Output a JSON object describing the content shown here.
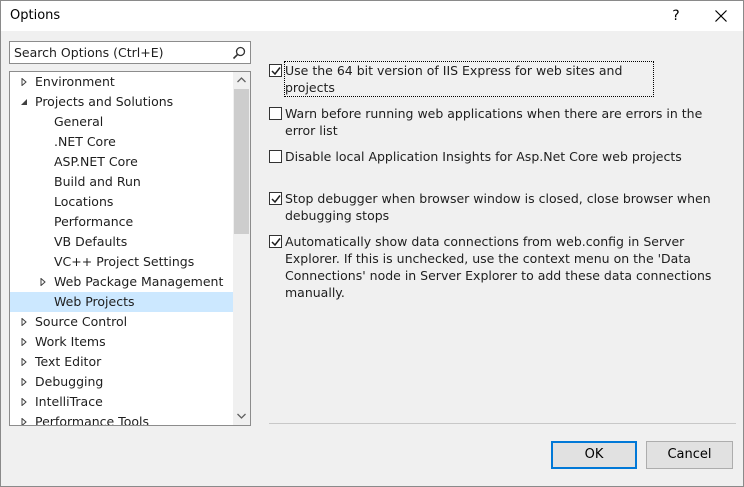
{
  "window": {
    "title": "Options",
    "help_label": "?"
  },
  "search": {
    "text": "Search Options (Ctrl+E)"
  },
  "tree": {
    "items": [
      {
        "label": "Environment",
        "level": 0,
        "expander": "collapsed",
        "selected": false
      },
      {
        "label": "Projects and Solutions",
        "level": 0,
        "expander": "expanded",
        "selected": false
      },
      {
        "label": "General",
        "level": 1,
        "expander": "none",
        "selected": false
      },
      {
        "label": ".NET Core",
        "level": 1,
        "expander": "none",
        "selected": false
      },
      {
        "label": "ASP.NET Core",
        "level": 1,
        "expander": "none",
        "selected": false
      },
      {
        "label": "Build and Run",
        "level": 1,
        "expander": "none",
        "selected": false
      },
      {
        "label": "Locations",
        "level": 1,
        "expander": "none",
        "selected": false
      },
      {
        "label": "Performance",
        "level": 1,
        "expander": "none",
        "selected": false
      },
      {
        "label": "VB Defaults",
        "level": 1,
        "expander": "none",
        "selected": false
      },
      {
        "label": "VC++ Project Settings",
        "level": 1,
        "expander": "none",
        "selected": false
      },
      {
        "label": "Web Package Management",
        "level": 1,
        "expander": "collapsed",
        "selected": false
      },
      {
        "label": "Web Projects",
        "level": 1,
        "expander": "none",
        "selected": true
      },
      {
        "label": "Source Control",
        "level": 0,
        "expander": "collapsed",
        "selected": false
      },
      {
        "label": "Work Items",
        "level": 0,
        "expander": "collapsed",
        "selected": false
      },
      {
        "label": "Text Editor",
        "level": 0,
        "expander": "collapsed",
        "selected": false
      },
      {
        "label": "Debugging",
        "level": 0,
        "expander": "collapsed",
        "selected": false
      },
      {
        "label": "IntelliTrace",
        "level": 0,
        "expander": "collapsed",
        "selected": false
      },
      {
        "label": "Performance Tools",
        "level": 0,
        "expander": "collapsed",
        "selected": false
      }
    ]
  },
  "options": [
    {
      "text": "Use the 64 bit version of IIS Express for web sites and projects",
      "checked": true
    },
    {
      "text": "Warn before running web applications when there are errors in the error list",
      "checked": false
    },
    {
      "text": "Disable local Application Insights for Asp.Net Core web projects",
      "checked": false
    },
    {
      "text": "Stop debugger when browser window is closed, close browser when debugging stops",
      "checked": true
    },
    {
      "text": "Automatically show data connections from web.config in Server Explorer. If this is unchecked, use the context menu on the 'Data Connections' node in Server Explorer to add these data connections manually.",
      "checked": true
    }
  ],
  "buttons": {
    "ok": "OK",
    "cancel": "Cancel"
  },
  "colors": {
    "selection": "#cce8ff",
    "default_button_border": "#0078d7"
  }
}
